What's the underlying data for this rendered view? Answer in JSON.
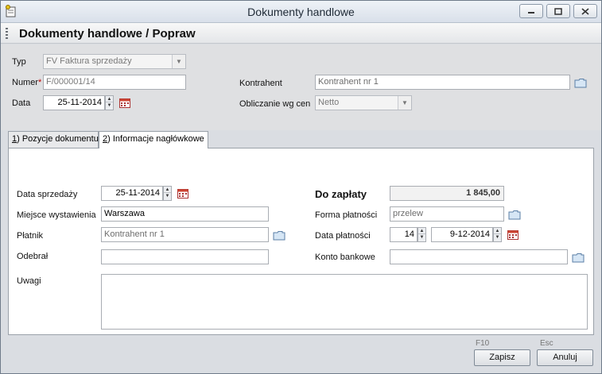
{
  "window": {
    "title": "Dokumenty handlowe"
  },
  "header": {
    "title": "Dokumenty handlowe / Popraw"
  },
  "form": {
    "typ_label": "Typ",
    "typ_value": "FV Faktura sprzedaży",
    "numer_label": "Numer",
    "numer_required": "*",
    "numer_value": "F/000001/14",
    "data_label": "Data",
    "data_value": "25-11-2014",
    "kontrahent_label": "Kontrahent",
    "kontrahent_value": "Kontrahent nr 1",
    "obliczanie_label": "Obliczanie wg cen",
    "obliczanie_value": "Netto"
  },
  "tabs": [
    {
      "hotkey": "1",
      "label": ") Pozycje dokumentu"
    },
    {
      "hotkey": "2",
      "label": ") Informacje nagłówkowe"
    }
  ],
  "details": {
    "data_sprzedazy_label": "Data sprzedaży",
    "data_sprzedazy_value": "25-11-2014",
    "miejsce_label": "Miejsce wystawienia",
    "miejsce_value": "Warszawa",
    "platnik_label": "Płatnik",
    "platnik_value": "Kontrahent nr 1",
    "odebral_label": "Odebrał",
    "odebral_value": "",
    "uwagi_label": "Uwagi",
    "uwagi_value": "",
    "do_zaplaty_label": "Do zapłaty",
    "do_zaplaty_value": "1 845,00",
    "forma_label": "Forma płatności",
    "forma_value": "przelew",
    "data_platnosci_label": "Data płatności",
    "dni_value": "14",
    "data_platnosci_value": "9-12-2014",
    "konto_label": "Konto bankowe",
    "konto_value": ""
  },
  "footer": {
    "save_hotkey": "F10",
    "save_label": "Zapisz",
    "cancel_hotkey": "Esc",
    "cancel_label": "Anuluj"
  },
  "colors": {
    "title_bar": "#d9e0ea",
    "background": "#dadde2",
    "required": "#c00000"
  }
}
